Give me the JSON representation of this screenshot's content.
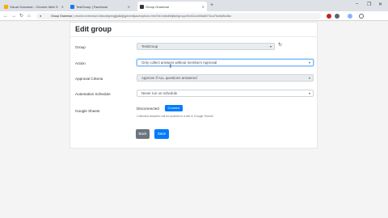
{
  "browser": {
    "tabs": [
      {
        "label": "Visual Grammar - Chrome Web S",
        "favicon_color": "#f9ab00",
        "active": false
      },
      {
        "label": "TestGroup | Facebook",
        "favicon_color": "#1877f2",
        "active": false
      },
      {
        "label": "Group Grammar",
        "favicon_color": "#333333",
        "active": true
      }
    ],
    "new_tab_symbol": "+",
    "window_controls": [
      "–",
      "❐",
      "✕"
    ],
    "nav": {
      "back": "←",
      "forward": "→",
      "reload": "↻",
      "home": "⌂"
    },
    "address": {
      "host": "Group Grammar",
      "path": " | chrome-extension://abcdegmngjljalkdjlgpkmnlkjaoe/options.html?id=hdbdbfdjfa#/group/4fc451a1fd5a6f27bcd7fa4faf5cd6a"
    }
  },
  "page": {
    "title": "Edit group",
    "group": {
      "label": "Group",
      "value": "TestGroup"
    },
    "action": {
      "label": "Action",
      "value": "Only collect answers without members Approval"
    },
    "approval": {
      "label": "Approval Criteria",
      "value": "Approve if ALL questions answered"
    },
    "schedule": {
      "label": "Automation Schedule",
      "value": "Never run on schedule"
    },
    "sheets": {
      "label": "Google Sheets",
      "status": "Disconnected",
      "connect_label": "Connect",
      "help": "Collected answers will be pushed to a tab in Google Sheets"
    },
    "back_label": "Back",
    "save_label": "Save"
  },
  "colors": {
    "primary": "#007bff",
    "secondary": "#6c757d"
  }
}
